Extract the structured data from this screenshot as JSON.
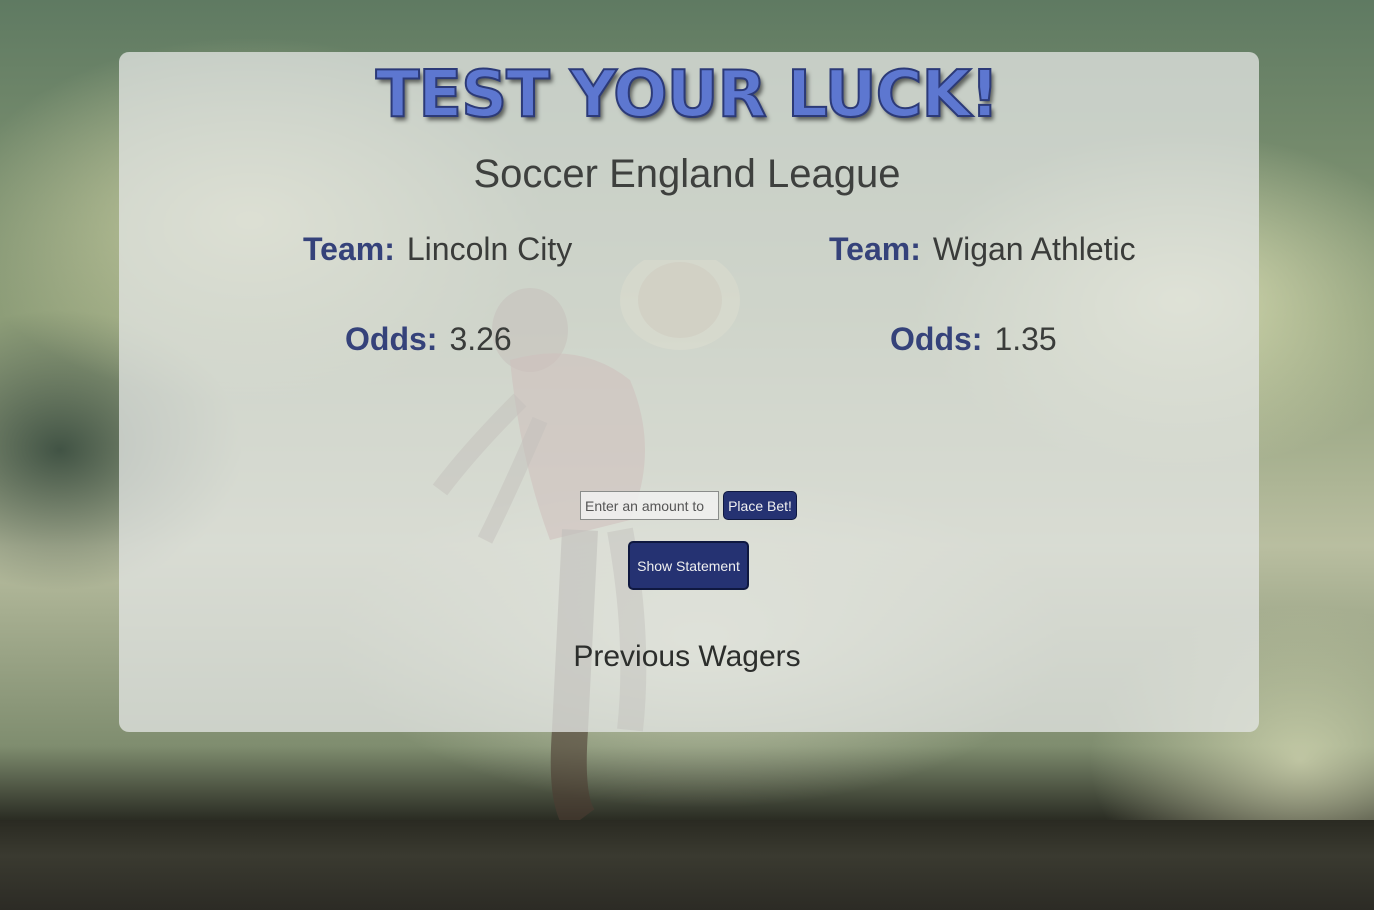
{
  "header": {
    "title": "Test Your Luck!",
    "league": "Soccer England League"
  },
  "matchup": {
    "team_label": "Team:",
    "odds_label": "Odds:",
    "home": {
      "team": "Lincoln City",
      "odds": "3.26"
    },
    "away": {
      "team": "Wigan Athletic",
      "odds": "1.35"
    }
  },
  "bet_form": {
    "amount_placeholder": "Enter an amount to",
    "place_bet_label": "Place Bet!",
    "show_statement_label": "Show Statement"
  },
  "wagers": {
    "heading": "Previous Wagers"
  },
  "colors": {
    "accent": "#253272",
    "title": "#5d77d0",
    "label": "#35427a"
  }
}
